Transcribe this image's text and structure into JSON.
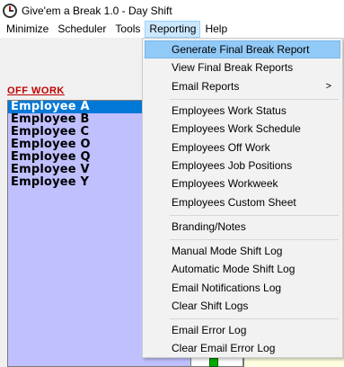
{
  "window": {
    "title": "Give'em a Break 1.0  - Day Shift"
  },
  "menubar": {
    "items": [
      {
        "label": "Minimize"
      },
      {
        "label": "Scheduler"
      },
      {
        "label": "Tools"
      },
      {
        "label": "Reporting"
      },
      {
        "label": "Help"
      }
    ]
  },
  "off_work": {
    "label": "OFF WORK",
    "employees": [
      "Employee A",
      "Employee B",
      "Employee C",
      "Employee O",
      "Employee Q",
      "Employee V",
      "Employee Y"
    ]
  },
  "reporting_menu": {
    "items": [
      {
        "label": "Generate Final Break Report"
      },
      {
        "label": "View Final Break Reports"
      },
      {
        "label": "Email Reports",
        "submenu_arrow": ">"
      },
      {
        "label": "Employees Work Status"
      },
      {
        "label": "Employees Work Schedule"
      },
      {
        "label": "Employees Off Work"
      },
      {
        "label": "Employees Job Positions"
      },
      {
        "label": "Employees Workweek"
      },
      {
        "label": "Employees Custom Sheet"
      },
      {
        "label": "Branding/Notes"
      },
      {
        "label": "Manual Mode Shift Log"
      },
      {
        "label": "Automatic Mode Shift Log"
      },
      {
        "label": "Email Notifications Log"
      },
      {
        "label": "Clear Shift Logs"
      },
      {
        "label": "Email Error Log"
      },
      {
        "label": "Clear Email Error Log"
      }
    ]
  },
  "colors": {
    "menu_highlight": "#91c9f7",
    "list_bg": "#c0c0ff",
    "selected_bg": "#0078d7",
    "off_work_label": "#c00000"
  }
}
